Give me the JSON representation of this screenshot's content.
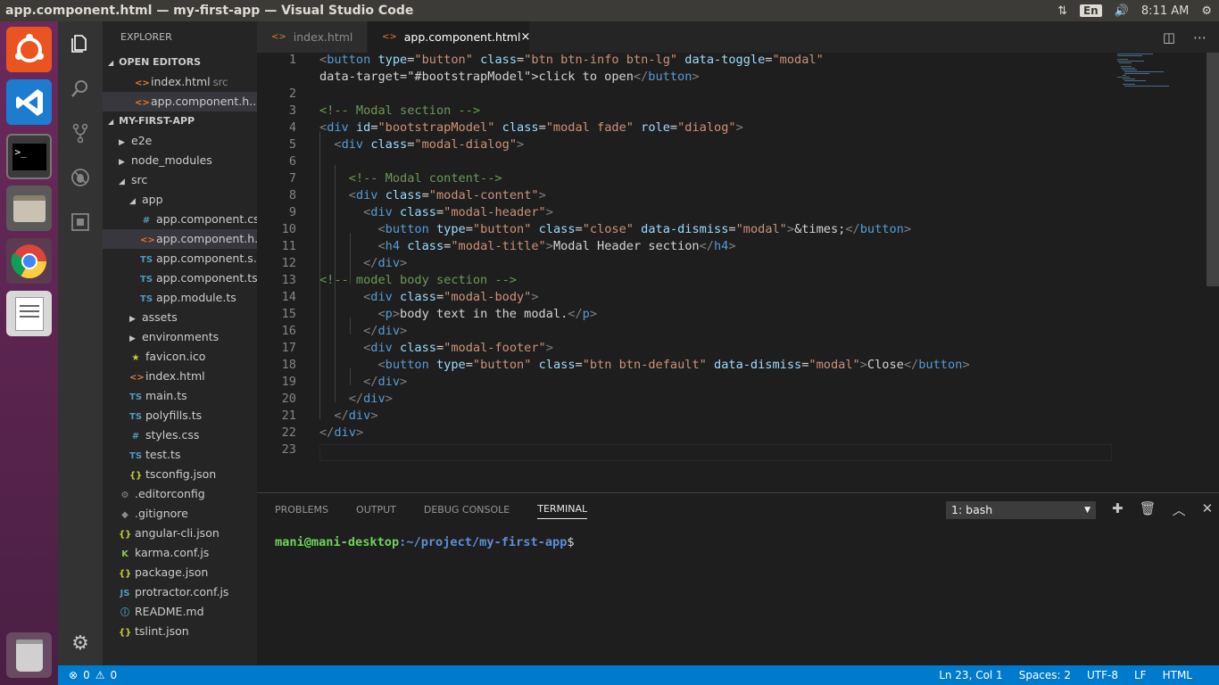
{
  "window": {
    "title": "app.component.html — my-first-app — Visual Studio Code",
    "clock": "8:11 AM",
    "lang": "En"
  },
  "launcher": {
    "items": [
      "ubuntu-dash",
      "vscode",
      "terminal",
      "files",
      "chrome",
      "text-editor",
      "trash"
    ]
  },
  "explorer": {
    "title": "EXPLORER",
    "open_editors_label": "OPEN EDITORS",
    "open_editors": [
      {
        "name": "index.html",
        "sub": "src"
      },
      {
        "name": "app.component.h..."
      }
    ],
    "project_label": "MY-FIRST-APP",
    "tree": [
      {
        "name": "e2e",
        "type": "folder"
      },
      {
        "name": "node_modules",
        "type": "folder"
      },
      {
        "name": "src",
        "type": "folder-open"
      },
      {
        "name": "app",
        "type": "folder-open"
      },
      {
        "name": "app.component.css",
        "type": "css"
      },
      {
        "name": "app.component.h...",
        "type": "html"
      },
      {
        "name": "app.component.s...",
        "type": "ts"
      },
      {
        "name": "app.component.ts",
        "type": "ts"
      },
      {
        "name": "app.module.ts",
        "type": "ts"
      },
      {
        "name": "assets",
        "type": "folder"
      },
      {
        "name": "environments",
        "type": "folder"
      },
      {
        "name": "favicon.ico",
        "type": "star"
      },
      {
        "name": "index.html",
        "type": "html"
      },
      {
        "name": "main.ts",
        "type": "ts"
      },
      {
        "name": "polyfills.ts",
        "type": "ts"
      },
      {
        "name": "styles.css",
        "type": "css"
      },
      {
        "name": "test.ts",
        "type": "ts"
      },
      {
        "name": "tsconfig.json",
        "type": "json"
      },
      {
        "name": ".editorconfig",
        "type": "gear"
      },
      {
        "name": ".gitignore",
        "type": "git"
      },
      {
        "name": "angular-cli.json",
        "type": "json"
      },
      {
        "name": "karma.conf.js",
        "type": "karma"
      },
      {
        "name": "package.json",
        "type": "json"
      },
      {
        "name": "protractor.conf.js",
        "type": "js"
      },
      {
        "name": "README.md",
        "type": "info"
      },
      {
        "name": "tslint.json",
        "type": "json"
      }
    ]
  },
  "tabs": [
    {
      "label": "index.html"
    },
    {
      "label": "app.component.html",
      "close": "×"
    }
  ],
  "line_numbers": [
    "1",
    "2",
    "3",
    "4",
    "5",
    "6",
    "7",
    "8",
    "9",
    "10",
    "11",
    "12",
    "13",
    "14",
    "15",
    "16",
    "17",
    "18",
    "19",
    "20",
    "21",
    "22",
    "23"
  ],
  "code": [
    "<button type=\"button\" class=\"btn btn-info btn-lg\" data-toggle=\"modal\"",
    "data-target=\"#bootstrapModel\">click to open</button>",
    "",
    "<!-- Modal section -->",
    "<div id=\"bootstrapModel\" class=\"modal fade\" role=\"dialog\">",
    "  <div class=\"modal-dialog\">",
    "",
    "    <!-- Modal content-->",
    "    <div class=\"modal-content\">",
    "      <div class=\"modal-header\">",
    "        <button type=\"button\" class=\"close\" data-dismiss=\"modal\">&times;</button>",
    "        <h4 class=\"modal-title\">Modal Header section</h4>",
    "      </div>",
    "<!-- model body section -->",
    "      <div class=\"modal-body\">",
    "        <p>body text in the modal.</p>",
    "      </div>",
    "      <div class=\"modal-footer\">",
    "        <button type=\"button\" class=\"btn btn-default\" data-dismiss=\"modal\">Close</button>",
    "      </div>",
    "    </div>",
    "  </div>",
    "</div>",
    ""
  ],
  "panel": {
    "tabs": [
      "PROBLEMS",
      "OUTPUT",
      "DEBUG CONSOLE",
      "TERMINAL"
    ],
    "terminal_select": "1: bash",
    "prompt_user": "mani@mani-desktop",
    "prompt_path": ":~/project/my-first-app",
    "prompt_end": "$"
  },
  "status": {
    "errors": "0",
    "warnings": "0",
    "position": "Ln 23, Col 1",
    "spaces": "Spaces: 2",
    "encoding": "UTF-8",
    "eol": "LF",
    "language": "HTML"
  },
  "colors": {
    "accent": "#007acc",
    "launcher": "#5e2750",
    "html_icon": "#e37933",
    "ts_icon": "#519aba",
    "json_icon": "#cbcb41"
  }
}
